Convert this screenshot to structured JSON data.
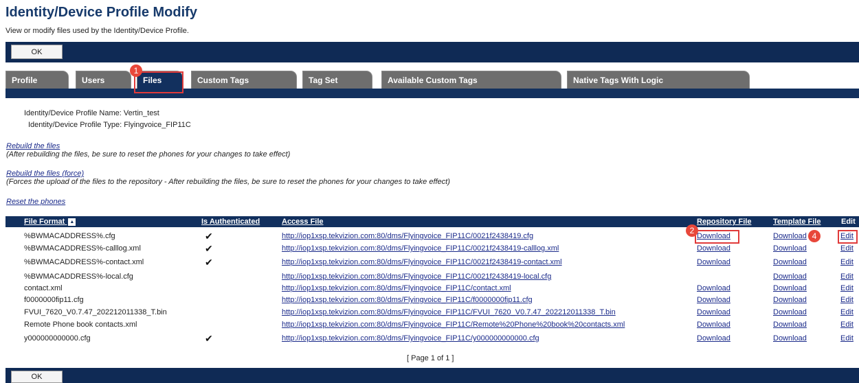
{
  "header": {
    "title": "Identity/Device Profile Modify",
    "subtitle": "View or modify files used by the Identity/Device Profile."
  },
  "ok_label": "OK",
  "tabs": [
    {
      "label": "Profile"
    },
    {
      "label": "Users"
    },
    {
      "label": "Files"
    },
    {
      "label": "Custom Tags"
    },
    {
      "label": "Tag Set"
    },
    {
      "label": "Available Custom Tags"
    },
    {
      "label": "Native Tags With Logic"
    }
  ],
  "active_tab": "Files",
  "profile_info": {
    "name_line": "Identity/Device Profile Name: Vertin_test",
    "type_line": "Identity/Device Profile Type: Flyingvoice_FIP11C"
  },
  "actions": {
    "rebuild": {
      "label": "Rebuild the files",
      "note": "(After rebuilding the files, be sure to reset the phones for your changes to take effect)"
    },
    "rebuild_force": {
      "label": "Rebuild the files (force)",
      "note": "(Forces the upload of the files to the repository - After rebuilding the files, be sure to reset the phones for your changes to take effect)"
    },
    "reset": {
      "label": "Reset the phones"
    }
  },
  "table": {
    "columns": [
      "File Format",
      "Is Authenticated",
      "Access File",
      "Repository File",
      "Template File",
      "Edit"
    ],
    "rows": [
      {
        "format": "%BWMACADDRESS%.cfg",
        "auth": "✔",
        "access": "http://iop1xsp.tekvizion.com:80/dms/Flyingvoice_FIP11C/0021f2438419.cfg",
        "repo": "Download",
        "template": "Download",
        "edit": "Edit"
      },
      {
        "format": "%BWMACADDRESS%-calllog.xml",
        "auth": "✔",
        "access": "http://iop1xsp.tekvizion.com:80/dms/Flyingvoice_FIP11C/0021f2438419-calllog.xml",
        "repo": "Download",
        "template": "Download",
        "edit": "Edit"
      },
      {
        "format": "%BWMACADDRESS%-contact.xml",
        "auth": "✔",
        "access": "http://iop1xsp.tekvizion.com:80/dms/Flyingvoice_FIP11C/0021f2438419-contact.xml",
        "repo": "Download",
        "template": "Download",
        "edit": "Edit"
      },
      {
        "format": "%BWMACADDRESS%-local.cfg",
        "auth": "",
        "access": "http://iop1xsp.tekvizion.com:80/dms/Flyingvoice_FIP11C/0021f2438419-local.cfg",
        "repo": "",
        "template": "Download",
        "edit": "Edit"
      },
      {
        "format": "contact.xml",
        "auth": "",
        "access": "http://iop1xsp.tekvizion.com:80/dms/Flyingvoice_FIP11C/contact.xml",
        "repo": "Download",
        "template": "Download",
        "edit": "Edit"
      },
      {
        "format": "f0000000fip11.cfg",
        "auth": "",
        "access": "http://iop1xsp.tekvizion.com:80/dms/Flyingvoice_FIP11C/f0000000fip11.cfg",
        "repo": "Download",
        "template": "Download",
        "edit": "Edit"
      },
      {
        "format": "FVUI_7620_V0.7.47_202212011338_T.bin",
        "auth": "",
        "access": "http://iop1xsp.tekvizion.com:80/dms/Flyingvoice_FIP11C/FVUI_7620_V0.7.47_202212011338_T.bin",
        "repo": "Download",
        "template": "Download",
        "edit": "Edit"
      },
      {
        "format": "Remote Phone book contacts.xml",
        "auth": "",
        "access": "http://iop1xsp.tekvizion.com:80/dms/Flyingvoice_FIP11C/Remote%20Phone%20book%20contacts.xml",
        "repo": "Download",
        "template": "Download",
        "edit": "Edit"
      },
      {
        "format": "y000000000000.cfg",
        "auth": "✔",
        "access": "http://iop1xsp.tekvizion.com:80/dms/Flyingvoice_FIP11C/y000000000000.cfg",
        "repo": "Download",
        "template": "Download",
        "edit": "Edit"
      }
    ]
  },
  "pagination": "[ Page 1 of 1 ]",
  "step_badges": [
    "1",
    "2",
    "4"
  ],
  "colors": {
    "navy": "#12305e",
    "tab_gray": "#6e6e6e",
    "marker_red": "#e03a3a",
    "link_blue": "#1a2a8a"
  }
}
